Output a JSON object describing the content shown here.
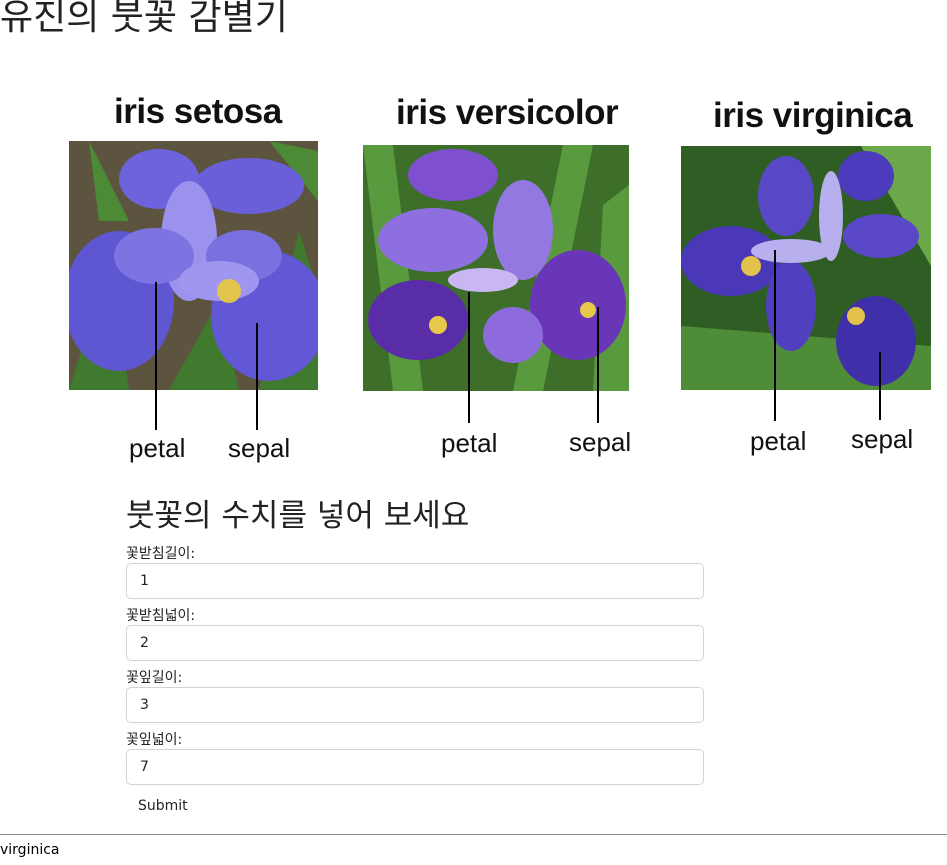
{
  "page": {
    "title": "유진의 붓꽃 감별기"
  },
  "species": [
    {
      "name": "iris setosa",
      "label_petal": "petal",
      "label_sepal": "sepal"
    },
    {
      "name": "iris versicolor",
      "label_petal": "petal",
      "label_sepal": "sepal"
    },
    {
      "name": "iris virginica",
      "label_petal": "petal",
      "label_sepal": "sepal"
    }
  ],
  "form": {
    "heading": "붓꽃의 수치를 넣어 보세요",
    "fields": [
      {
        "label": "꽃받침길이:",
        "value": "1"
      },
      {
        "label": "꽃받침넓이:",
        "value": "2"
      },
      {
        "label": "꽃잎길이:",
        "value": "3"
      },
      {
        "label": "꽃잎넓이:",
        "value": "7"
      }
    ],
    "submit_label": "Submit"
  },
  "result": {
    "text": "virginica"
  },
  "colors": {
    "flower_blue": "#6a5fd8",
    "foliage_green": "#3f7a2e",
    "border": "#ced4da"
  }
}
